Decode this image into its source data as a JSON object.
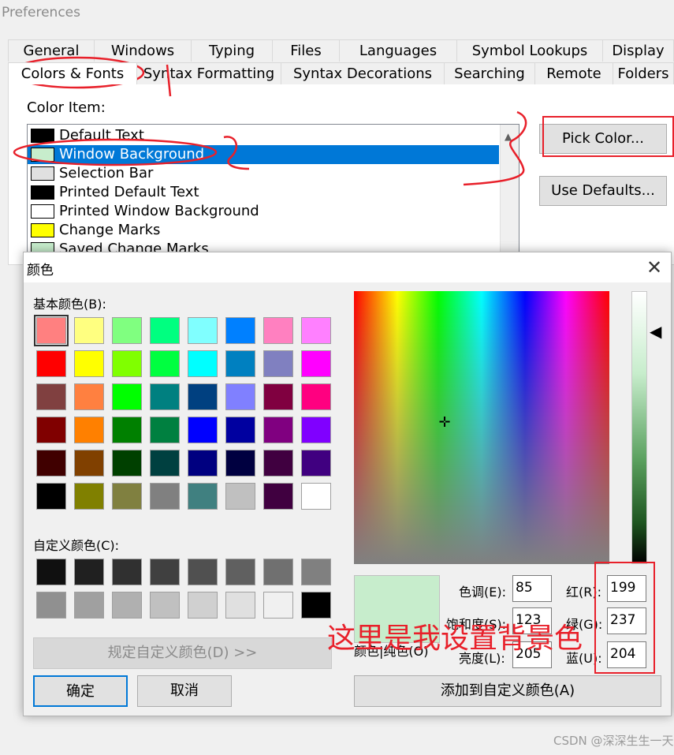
{
  "preferences": {
    "title": "Preferences",
    "tabs_row1": [
      "General",
      "Windows",
      "Typing",
      "Files",
      "Languages",
      "Symbol Lookups",
      "Display"
    ],
    "tabs_row2": [
      "Colors & Fonts",
      "Syntax Formatting",
      "Syntax Decorations",
      "Searching",
      "Remote",
      "Folders"
    ],
    "selected_tab": "Colors & Fonts",
    "color_item_label": "Color Item:",
    "color_items": [
      {
        "label": "Default Text",
        "swatch": "#000000"
      },
      {
        "label": "Window Background",
        "swatch": "#c7edcc"
      },
      {
        "label": "Selection Bar",
        "swatch": "#e0e0e0"
      },
      {
        "label": "Printed Default Text",
        "swatch": "#000000"
      },
      {
        "label": "Printed Window Background",
        "swatch": "#ffffff"
      },
      {
        "label": "Change Marks",
        "swatch": "#ffff00"
      },
      {
        "label": "Saved Change Marks",
        "swatch": "#c7edcc"
      }
    ],
    "selected_item": "Window Background",
    "pick_color_button": "Pick Color...",
    "use_defaults_button": "Use Defaults..."
  },
  "color_dialog": {
    "title": "颜色",
    "close_glyph": "✕",
    "basic_colors_label": "基本颜色(B):",
    "basic_colors": [
      "#ff8080",
      "#ffff80",
      "#80ff80",
      "#00ff80",
      "#80ffff",
      "#0080ff",
      "#ff80c0",
      "#ff80ff",
      "#ff0000",
      "#ffff00",
      "#80ff00",
      "#00ff40",
      "#00ffff",
      "#0080c0",
      "#8080c0",
      "#ff00ff",
      "#804040",
      "#ff8040",
      "#00ff00",
      "#008080",
      "#004080",
      "#8080ff",
      "#800040",
      "#ff0080",
      "#800000",
      "#ff8000",
      "#008000",
      "#008040",
      "#0000ff",
      "#0000a0",
      "#800080",
      "#8000ff",
      "#400000",
      "#804000",
      "#004000",
      "#004040",
      "#000080",
      "#000040",
      "#400040",
      "#400080",
      "#000000",
      "#808000",
      "#808040",
      "#808080",
      "#408080",
      "#c0c0c0",
      "#400040",
      "#ffffff"
    ],
    "custom_colors_label": "自定义颜色(C):",
    "custom_colors": [
      "#101010",
      "#202020",
      "#303030",
      "#404040",
      "#505050",
      "#606060",
      "#707070",
      "#808080",
      "#909090",
      "#a0a0a0",
      "#b0b0b0",
      "#c0c0c0",
      "#d0d0d0",
      "#e0e0e0",
      "#f0f0f0",
      "#000000"
    ],
    "define_custom_button": "规定自定义颜色(D) >>",
    "ok_button": "确定",
    "cancel_button": "取消",
    "crosshair_glyph": "✛",
    "lum_arrow_glyph": "◀",
    "preview_color": "#c7edcc",
    "solid_label": "颜色|纯色(O)",
    "hue_label": "色调(E):",
    "hue": "85",
    "sat_label": "饱和度(S):",
    "sat": "123",
    "lum_label": "亮度(L):",
    "lum": "205",
    "red_label": "红(R):",
    "red": "199",
    "green_label": "绿(G):",
    "green": "237",
    "blue_label": "蓝(U):",
    "blue": "204",
    "add_custom_button": "添加到自定义颜色(A)"
  },
  "annotation": {
    "text": "这里是我设置背景色",
    "color": "#e8202a"
  },
  "watermark": "CSDN @深深生生一天"
}
